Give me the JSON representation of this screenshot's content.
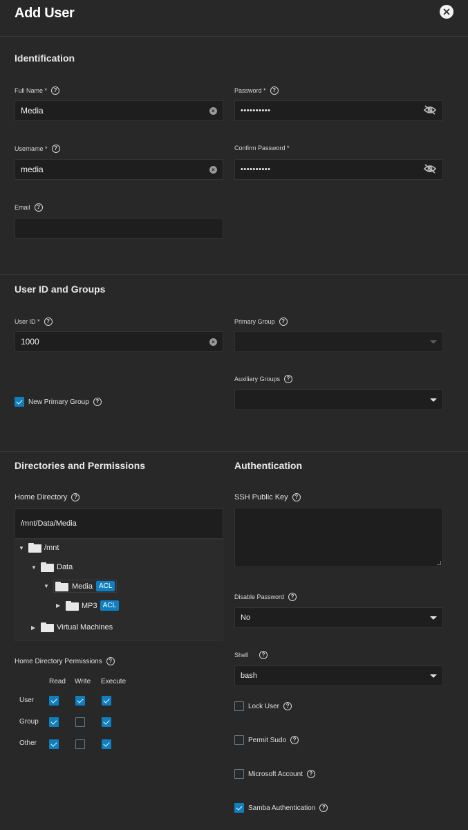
{
  "header": {
    "title": "Add User"
  },
  "identification": {
    "title": "Identification",
    "full_name": {
      "label": "Full Name *",
      "value": "Media"
    },
    "password": {
      "label": "Password *",
      "value": "••••••••••"
    },
    "username": {
      "label": "Username *",
      "value": "media"
    },
    "confirm_password": {
      "label": "Confirm Password *",
      "value": "••••••••••"
    },
    "email": {
      "label": "Email",
      "value": ""
    }
  },
  "user_id_groups": {
    "title": "User ID and Groups",
    "user_id": {
      "label": "User ID *",
      "value": "1000"
    },
    "primary_group": {
      "label": "Primary Group",
      "value": ""
    },
    "auxiliary_groups": {
      "label": "Auxiliary Groups",
      "value": ""
    },
    "new_primary_group": {
      "label": "New Primary Group",
      "checked": true
    }
  },
  "directories": {
    "title": "Directories and Permissions",
    "home_dir_label": "Home Directory",
    "home_dir_value": "/mnt/Data/Media",
    "tree": {
      "mnt": "/mnt",
      "data": "Data",
      "media": "Media",
      "mp3": "MP3",
      "vms": "Virtual Machines",
      "acl": "ACL"
    },
    "perm_label": "Home Directory Permissions",
    "perm_cols": [
      "Read",
      "Write",
      "Execute"
    ],
    "perm_rows": [
      {
        "name": "User",
        "read": true,
        "write": true,
        "execute": true
      },
      {
        "name": "Group",
        "read": true,
        "write": false,
        "execute": true
      },
      {
        "name": "Other",
        "read": true,
        "write": false,
        "execute": true
      }
    ]
  },
  "authentication": {
    "title": "Authentication",
    "ssh_label": "SSH Public Key",
    "ssh_value": "",
    "disable_password": {
      "label": "Disable Password",
      "value": "No"
    },
    "shell": {
      "label": "Shell",
      "value": "bash"
    },
    "lock_user": {
      "label": "Lock User",
      "checked": false
    },
    "permit_sudo": {
      "label": "Permit Sudo",
      "checked": false
    },
    "microsoft_account": {
      "label": "Microsoft Account",
      "checked": false
    },
    "samba_auth": {
      "label": "Samba Authentication",
      "checked": true
    }
  },
  "icons": {
    "help": "?",
    "clear": "×",
    "close": "✕"
  }
}
